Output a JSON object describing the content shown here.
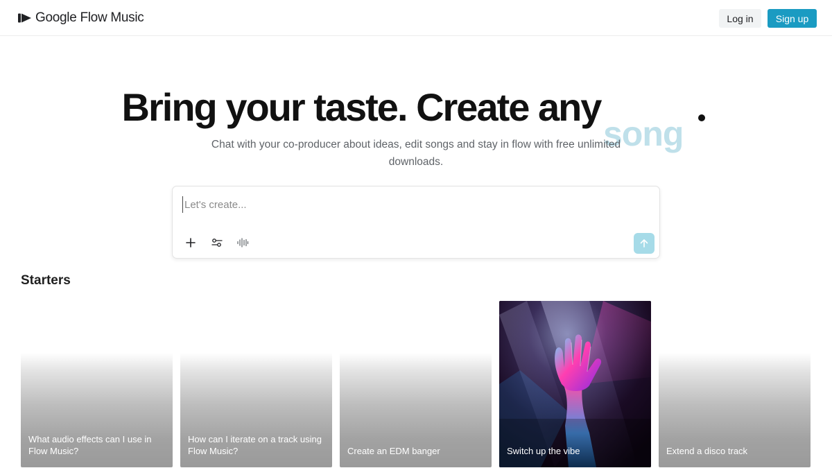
{
  "app": {
    "name": "Google Flow Music"
  },
  "header": {
    "login_label": "Log in",
    "signup_label": "Sign up",
    "signup_color": "#1a9bc2"
  },
  "hero": {
    "title": "Bring your taste. Create any",
    "animated_word": "song",
    "subtitle": "Chat with your co-producer about ideas, edit songs and stay in flow with free unlimited downloads."
  },
  "prompt": {
    "placeholder": "Let's create...",
    "value": "",
    "tools": [
      "plus-icon",
      "sliders-icon",
      "waveform-icon"
    ],
    "send_icon": "arrow-up-icon"
  },
  "starters": {
    "heading": "Starters",
    "cards": [
      {
        "label": "What audio effects can I use in Flow Music?"
      },
      {
        "label": "How can I iterate on a track using Flow Music?"
      },
      {
        "label": "Create an EDM banger"
      },
      {
        "label": "Switch up the vibe",
        "image": "neon-hand-light-beams"
      },
      {
        "label": "Extend a disco track"
      }
    ]
  }
}
